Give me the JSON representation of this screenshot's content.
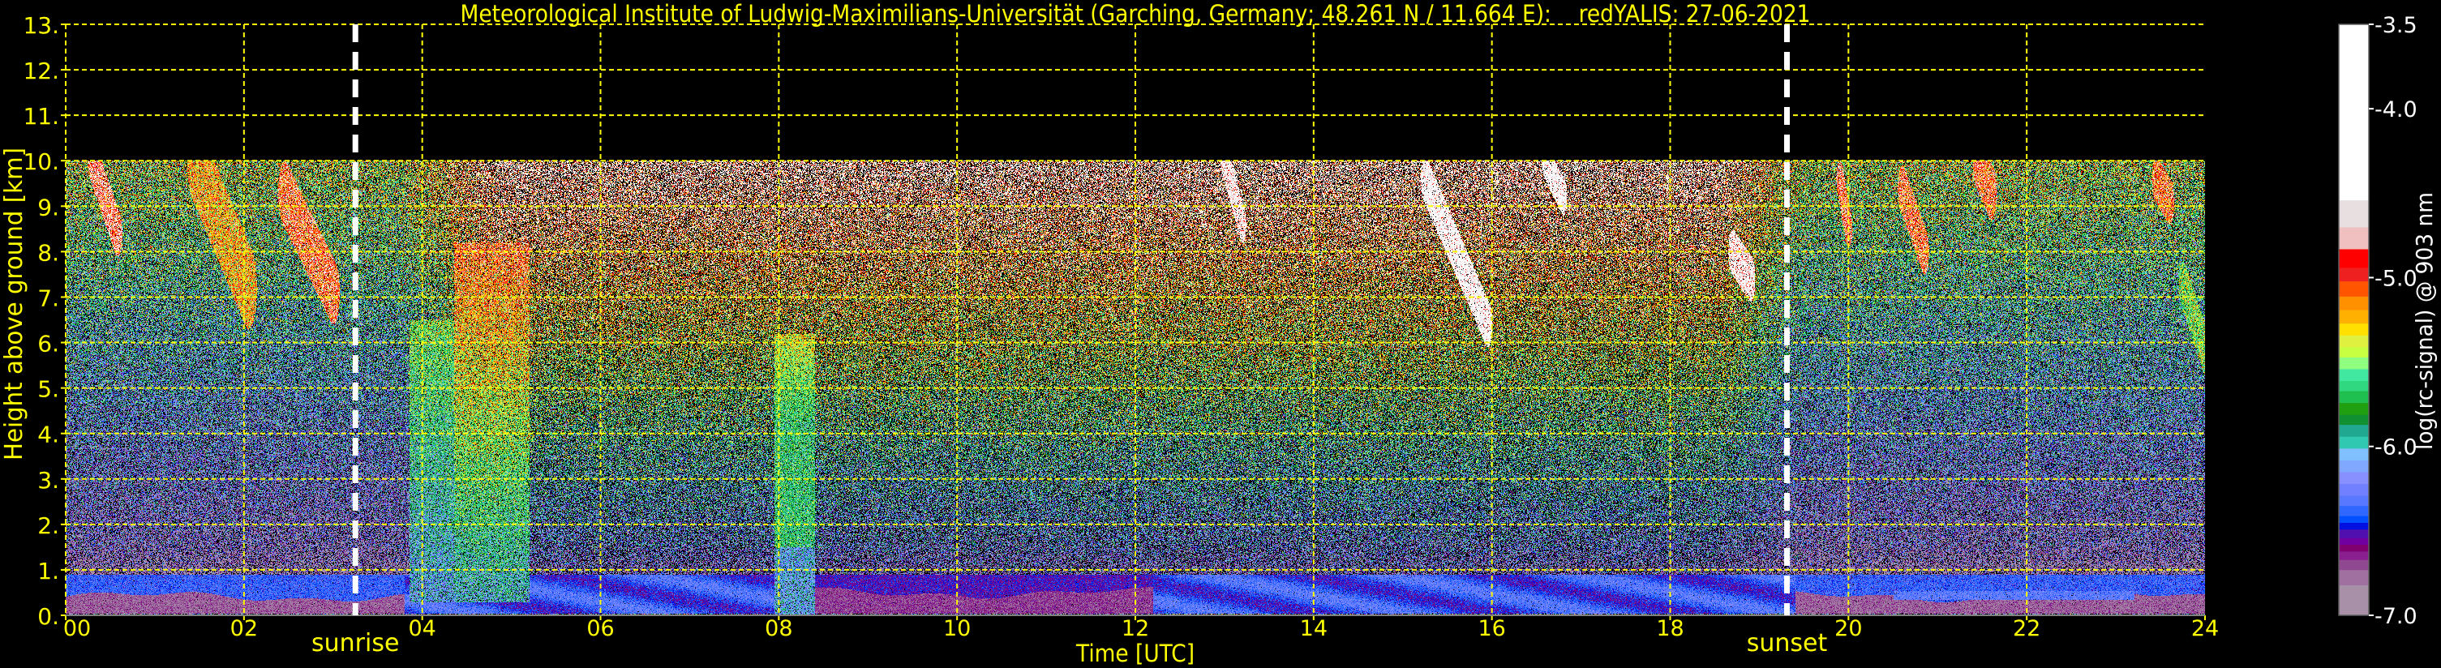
{
  "chart_data": {
    "type": "heatmap",
    "title": "Meteorological Institute of Ludwig-Maximilians-Universität (Garching, Germany; 48.261 N / 11.664 E):    redYALIS: 27-06-2021",
    "xlabel": "Time [UTC]",
    "ylabel": "Height above ground [km]",
    "xlim": [
      0,
      24
    ],
    "ylim": [
      0,
      13
    ],
    "data_max_height_km": 10,
    "grid": true,
    "xticks": [
      0,
      2,
      4,
      6,
      8,
      10,
      12,
      14,
      16,
      18,
      20,
      22,
      24
    ],
    "xtick_labels": [
      "00",
      "02",
      "04",
      "06",
      "08",
      "10",
      "12",
      "14",
      "16",
      "18",
      "20",
      "22",
      "24"
    ],
    "yticks": [
      0,
      1,
      2,
      3,
      4,
      5,
      6,
      7,
      8,
      9,
      10,
      11,
      12,
      13
    ],
    "ytick_labels": [
      "0.",
      "1.",
      "2.",
      "3.",
      "4.",
      "5.",
      "6.",
      "7.",
      "8.",
      "9.",
      "10.",
      "11.",
      "12.",
      "13."
    ],
    "markers": [
      {
        "label": "sunrise",
        "x": 3.25
      },
      {
        "label": "sunset",
        "x": 19.31
      }
    ],
    "colorbar": {
      "label": "log(rc-signal) @ 903 nm",
      "range": [
        -7.0,
        -3.5
      ],
      "ticks": [
        -3.5,
        -4.0,
        -5.0,
        -6.0,
        -7.0
      ],
      "tick_labels": [
        "-3.5",
        "-4.0",
        "-5.0",
        "-6.0",
        "-7.0"
      ],
      "levels": [
        -7.0,
        -6.82,
        -6.73,
        -6.67,
        -6.62,
        -6.58,
        -6.54,
        -6.49,
        -6.45,
        -6.41,
        -6.35,
        -6.29,
        -6.22,
        -6.15,
        -6.08,
        -6.01,
        -5.94,
        -5.87,
        -5.81,
        -5.74,
        -5.67,
        -5.61,
        -5.54,
        -5.47,
        -5.41,
        -5.34,
        -5.27,
        -5.19,
        -5.11,
        -5.02,
        -4.94,
        -4.83,
        -4.7,
        -4.54
      ],
      "colors": [
        "#a890a8",
        "#a070a0",
        "#904890",
        "#8a2090",
        "#800070",
        "#7000a0",
        "#5010b0",
        "#0010e0",
        "#0050ff",
        "#3068ff",
        "#5878ff",
        "#7080ff",
        "#8890ff",
        "#80a8ff",
        "#80c0ff",
        "#30c8b0",
        "#20a890",
        "#109030",
        "#20a010",
        "#20c050",
        "#30d880",
        "#40e8a0",
        "#90ff80",
        "#c8ff40",
        "#e0f040",
        "#ffe000",
        "#ffb000",
        "#ff9000",
        "#ff5500",
        "#ee2020",
        "#ff0000",
        "#f0c0c0",
        "#e8e0e0",
        "#ffffff"
      ]
    },
    "colors": {
      "text_axes": "#ffff00",
      "grid": "#ffff00",
      "markers": "#ffffff",
      "background": "#000000"
    }
  }
}
